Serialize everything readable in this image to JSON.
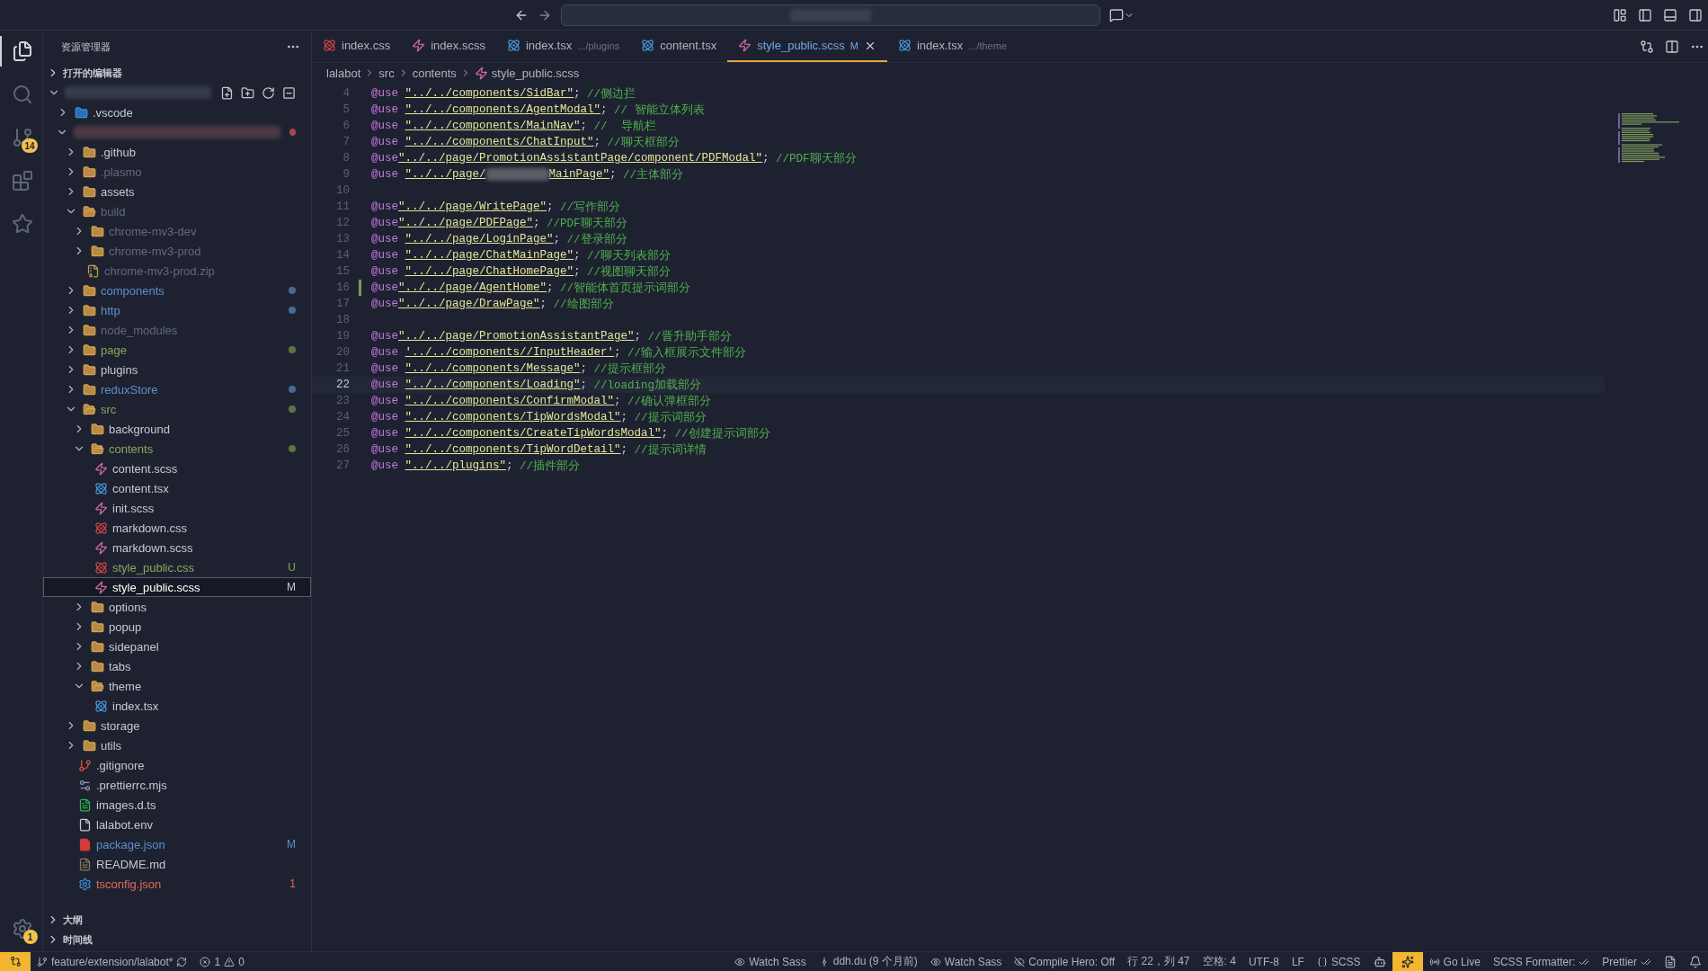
{
  "activity_bar": {
    "items": [
      {
        "kind": "files",
        "selected": true
      },
      {
        "kind": "search",
        "selected": false
      },
      {
        "kind": "scm",
        "selected": false,
        "badge": "14"
      },
      {
        "kind": "extensions",
        "selected": false
      },
      {
        "kind": "star",
        "selected": false
      }
    ],
    "settings_badge": "1"
  },
  "explorer": {
    "title": "资源管理器",
    "open_editors": "打开的编辑器",
    "tree": [
      {
        "expanded": true,
        "children": [
          {
            "name": ".vscode",
            "kind": "vscode",
            "expanded": false
          },
          {
            "expanded": true,
            "dot": {
              "color": "#a34b4b"
            },
            "children": [
              {
                "name": ".github",
                "kind": "folder",
                "expanded": false
              },
              {
                "name": ".plasmo",
                "kind": "folder",
                "expanded": false,
                "color": "#636a7a"
              },
              {
                "name": "assets",
                "kind": "folder",
                "expanded": false
              },
              {
                "name": "build",
                "kind": "folder",
                "expanded": true,
                "color": "#636a7a",
                "children": [
                  {
                    "name": "chrome-mv3-dev",
                    "kind": "folder",
                    "expanded": false,
                    "color": "#636a7a"
                  },
                  {
                    "name": "chrome-mv3-prod",
                    "kind": "folder",
                    "expanded": false,
                    "color": "#636a7a"
                  },
                  {
                    "name": "chrome-mv3-prod.zip",
                    "kind": "zip",
                    "color": "#636a7a"
                  }
                ]
              },
              {
                "name": "components",
                "kind": "folder",
                "expanded": false,
                "color": "#5e8fca",
                "dot": {
                  "color": "#4a6a94"
                }
              },
              {
                "name": "http",
                "kind": "folder",
                "expanded": false,
                "color": "#5e8fca",
                "dot": {
                  "color": "#4a6a94"
                }
              },
              {
                "name": "node_modules",
                "kind": "folder",
                "expanded": false,
                "color": "#636a7a"
              },
              {
                "name": "page",
                "kind": "folder",
                "expanded": false,
                "color": "#8aa85c",
                "dot": {
                  "color": "#5b7545"
                }
              },
              {
                "name": "plugins",
                "kind": "folder",
                "expanded": false
              },
              {
                "name": "reduxStore",
                "kind": "folder",
                "expanded": false,
                "color": "#5e8fca",
                "dot": {
                  "color": "#4a6a94"
                }
              },
              {
                "name": "src",
                "kind": "folder",
                "expanded": true,
                "color": "#8aa85c",
                "dot": {
                  "color": "#5b7545"
                },
                "children": [
                  {
                    "name": "background",
                    "kind": "folder",
                    "expanded": false
                  },
                  {
                    "name": "contents",
                    "kind": "folder",
                    "expanded": true,
                    "color": "#8aa85c",
                    "dot": {
                      "color": "#5b7545"
                    },
                    "children": [
                      {
                        "name": "content.scss",
                        "kind": "scss"
                      },
                      {
                        "name": "content.tsx",
                        "kind": "react"
                      },
                      {
                        "name": "init.scss",
                        "kind": "scss"
                      },
                      {
                        "name": "markdown.css",
                        "kind": "css"
                      },
                      {
                        "name": "markdown.scss",
                        "kind": "scss"
                      },
                      {
                        "name": "style_public.css",
                        "kind": "css",
                        "color": "#8aa85c",
                        "badge": "U"
                      },
                      {
                        "name": "style_public.scss",
                        "kind": "scss",
                        "badge": "M",
                        "selected": true
                      }
                    ]
                  },
                  {
                    "name": "options",
                    "kind": "folder",
                    "expanded": false
                  },
                  {
                    "name": "popup",
                    "kind": "folder",
                    "expanded": false
                  },
                  {
                    "name": "sidepanel",
                    "kind": "folder",
                    "expanded": false
                  },
                  {
                    "name": "tabs",
                    "kind": "folder",
                    "expanded": false
                  },
                  {
                    "name": "theme",
                    "kind": "folder",
                    "expanded": true,
                    "children": [
                      {
                        "name": "index.tsx",
                        "kind": "react"
                      }
                    ]
                  }
                ]
              },
              {
                "name": "storage",
                "kind": "folder",
                "expanded": false
              },
              {
                "name": "utils",
                "kind": "folder",
                "expanded": false
              },
              {
                "name": ".gitignore",
                "kind": "git"
              },
              {
                "name": ".prettierrc.mjs",
                "kind": "prettier"
              },
              {
                "name": "images.d.ts",
                "kind": "ts"
              },
              {
                "name": "lalabot.env",
                "kind": "file"
              },
              {
                "name": "package.json",
                "kind": "npm",
                "color": "#5e8fca",
                "badge": "M"
              },
              {
                "name": "README.md",
                "kind": "md"
              },
              {
                "name": "tsconfig.json",
                "kind": "tsconfig",
                "color": "#e06c5a",
                "badge": "1"
              }
            ]
          }
        ]
      }
    ],
    "sections": [
      "大纲",
      "时间线"
    ]
  },
  "tabs": [
    {
      "label": "index.css",
      "kind": "css",
      "selected": false
    },
    {
      "label": "index.scss",
      "kind": "scss",
      "selected": false
    },
    {
      "label": "index.tsx",
      "kind": "react",
      "hint": ".../plugins",
      "selected": false
    },
    {
      "label": "content.tsx",
      "kind": "react",
      "selected": false
    },
    {
      "label": "style_public.scss",
      "kind": "scss",
      "badge": "M",
      "selected": true
    },
    {
      "label": "index.tsx",
      "kind": "react",
      "hint": ".../theme",
      "selected": false
    }
  ],
  "breadcrumb": [
    "lalabot",
    "src",
    "contents",
    "style_public.scss"
  ],
  "code": [
    {
      "n": "4",
      "keyword": "@use",
      "spaced": true,
      "path": "\"../../components/SidBar\"",
      "end": ";",
      "comment": "//侧边拦"
    },
    {
      "n": "5",
      "keyword": "@use",
      "spaced": true,
      "path": "\"../../components/AgentModal\"",
      "end": ";",
      "comment": "// 智能立体列表"
    },
    {
      "n": "6",
      "keyword": "@use",
      "spaced": true,
      "path": "\"../../components/MainNav\"",
      "end": ";",
      "comment": "//  导航栏"
    },
    {
      "n": "7",
      "keyword": "@use",
      "spaced": true,
      "path": "\"../../components/ChatInput\"",
      "end": ";",
      "comment": "//聊天框部分"
    },
    {
      "n": "8",
      "keyword": "@use",
      "spaced": false,
      "path": "\"../../page/PromotionAssistantPage/component/PDFModal\"",
      "end": ";",
      "comment": "//PDF聊天部分"
    },
    {
      "n": "9",
      "keyword": "@use",
      "spaced": true,
      "path": "\"../../page/",
      "path_end": "MainPage\"",
      "end": ";",
      "comment": "//主体部分"
    },
    {
      "n": "10"
    },
    {
      "n": "11",
      "keyword": "@use",
      "spaced": false,
      "path": "\"../../page/WritePage\"",
      "end": ";",
      "comment": "//写作部分"
    },
    {
      "n": "12",
      "keyword": "@use",
      "spaced": false,
      "path": "\"../../page/PDFPage\"",
      "end": ";",
      "comment": "//PDF聊天部分"
    },
    {
      "n": "13",
      "keyword": "@use",
      "spaced": true,
      "path": "\"../../page/LoginPage\"",
      "end": ";",
      "comment": "//登录部分"
    },
    {
      "n": "14",
      "keyword": "@use",
      "spaced": true,
      "path": "\"../../page/ChatMainPage\"",
      "end": ";",
      "comment": "//聊天列表部分"
    },
    {
      "n": "15",
      "keyword": "@use",
      "spaced": true,
      "path": "\"../../page/ChatHomePage\"",
      "end": ";",
      "comment": "//视图聊天部分"
    },
    {
      "n": "16",
      "keyword": "@use",
      "spaced": false,
      "path": "\"../../page/AgentHome\"",
      "end": ";",
      "comment": "//智能体首页提示词部分",
      "changed": true
    },
    {
      "n": "17",
      "keyword": "@use",
      "spaced": false,
      "path": "\"../../page/DrawPage\"",
      "end": ";",
      "comment": "//绘图部分"
    },
    {
      "n": "18"
    },
    {
      "n": "19",
      "keyword": "@use",
      "spaced": false,
      "path": "\"../../page/PromotionAssistantPage\"",
      "end": ";",
      "comment": "//晋升助手部分"
    },
    {
      "n": "20",
      "keyword": "@use",
      "spaced": true,
      "path": "'../../components//InputHeader'",
      "end": ";",
      "comment": "//输入框展示文件部分"
    },
    {
      "n": "21",
      "keyword": "@use",
      "spaced": true,
      "path": "\"../../components/Message\"",
      "end": ";",
      "comment": "//提示框部分"
    },
    {
      "n": "22",
      "keyword": "@use",
      "spaced": true,
      "path": "\"../../components/Loading\"",
      "end": ";",
      "comment": "//loading加载部分",
      "current": true
    },
    {
      "n": "23",
      "keyword": "@use",
      "spaced": true,
      "path": "\"../../components/ConfirmModal\"",
      "end": ";",
      "comment": "//确认弹框部分"
    },
    {
      "n": "24",
      "keyword": "@use",
      "spaced": true,
      "path": "\"../../components/TipWordsModal\"",
      "end": ";",
      "comment": "//提示词部分"
    },
    {
      "n": "25",
      "keyword": "@use",
      "spaced": true,
      "path": "\"../../components/CreateTipWordsModal\"",
      "end": ";",
      "comment": "//创建提示词部分"
    },
    {
      "n": "26",
      "keyword": "@use",
      "spaced": true,
      "path": "\"../../components/TipWordDetail\"",
      "end": ";",
      "comment": "//提示词详情"
    },
    {
      "n": "27",
      "keyword": "@use",
      "spaced": true,
      "path": "\"../../plugins\"",
      "end": ";",
      "comment": "//插件部分"
    }
  ],
  "status_bar": {
    "branch": "feature/extension/lalabot*",
    "errors": "1",
    "warnings": "0",
    "right": [
      {
        "kind": "eye",
        "label": "Watch Sass"
      },
      {
        "kind": "commit",
        "label": "ddh.du (9 个月前)"
      },
      {
        "kind": "eye",
        "label": "Watch Sass"
      },
      {
        "kind": "eye-off",
        "label": "Compile Hero: Off"
      },
      {
        "kind": "text",
        "label": "行 22，列 47"
      },
      {
        "kind": "text",
        "label": "空格: 4"
      },
      {
        "kind": "text",
        "label": "UTF-8"
      },
      {
        "kind": "text",
        "label": "LF"
      },
      {
        "kind": "braces",
        "label": "SCSS"
      },
      {
        "kind": "copilot"
      },
      {
        "kind": "highlight"
      },
      {
        "kind": "radio",
        "label": "Go Live"
      },
      {
        "kind": "checks",
        "label": "SCSS Formatter:"
      },
      {
        "kind": "checks",
        "label": "Prettier"
      },
      {
        "kind": "doc"
      },
      {
        "kind": "bell"
      }
    ]
  }
}
